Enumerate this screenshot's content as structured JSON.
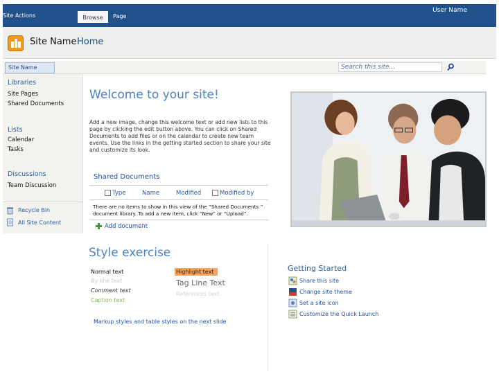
{
  "ribbon": {
    "site_actions": "Site Actions",
    "user_name": "User Name",
    "tabs": [
      {
        "label": "Browse"
      },
      {
        "label": "Page"
      }
    ]
  },
  "title_area": {
    "site_name": "Site Name",
    "breadcrumb_current": "Home"
  },
  "nav_strip": {
    "site_name_tab": "Site Name",
    "search_placeholder": "Search this site..."
  },
  "leftnav": {
    "libraries": {
      "heading": "Libraries",
      "items": [
        "Site Pages",
        "Shared Documents"
      ]
    },
    "lists": {
      "heading": "Lists",
      "items": [
        "Calendar",
        "Tasks"
      ]
    },
    "discussions": {
      "heading": "Discussions",
      "items": [
        "Team Discussion"
      ]
    },
    "bottom": {
      "recycle_bin": "Recycle Bin",
      "all_content": "All Site Content"
    }
  },
  "main": {
    "welcome_title": "Welcome to your site!",
    "welcome_text": "Add a new image, change this welcome text or add new lists to this page by clicking the edit button above. You can click on Shared Documents to add files or on the calendar to create new team events. Use the links in the getting started section to share your site and customize its look.",
    "shared_documents": {
      "title": "Shared Documents",
      "columns": [
        "Type",
        "Name",
        "Modified",
        "Modified by"
      ],
      "empty_message": "There are no items to show in this view of the “Shared Documents ” document library. To add a new item, click “New” or “Upload”.",
      "add_label": "Add document"
    },
    "style_exercise": {
      "title": "Style exercise",
      "normal": "Normal text",
      "byline": "By line text",
      "comment": "Comment text",
      "caption": "Caption text",
      "highlight": "Highlight text",
      "tagline": "Tag Line Text",
      "references": "References text",
      "markup_note": "Markup styles and table styles on the next  slide"
    },
    "getting_started": {
      "title": "Getting Started",
      "items": [
        "Share this site",
        "Change site theme",
        "Set a site icon",
        "Customize the Quick Launch"
      ]
    }
  },
  "colors": {
    "ribbon": "#21518b",
    "accent_title": "#4b83c2",
    "link": "#1f4e9a",
    "highlight_bg": "#f7a35c"
  }
}
